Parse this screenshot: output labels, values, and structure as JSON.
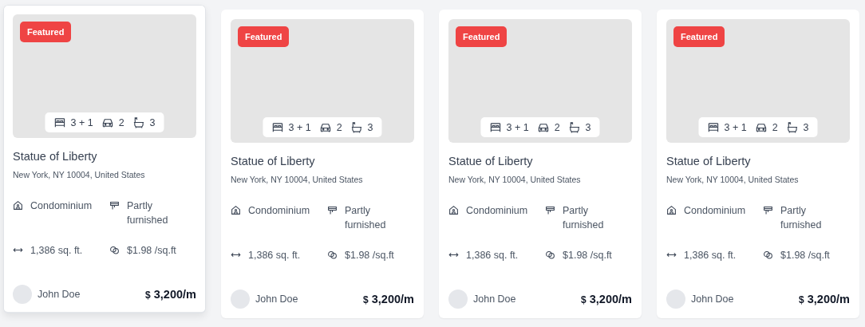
{
  "cards": [
    {
      "raised": true,
      "badge": "Featured",
      "stats": [
        {
          "kind": "beds",
          "text": "3 + 1"
        },
        {
          "kind": "parking",
          "text": "2"
        },
        {
          "kind": "baths",
          "text": "3"
        }
      ],
      "title": "Statue of Liberty",
      "address": "New York, NY 10004, United States",
      "features": [
        {
          "kind": "type",
          "text": "Condominium"
        },
        {
          "kind": "furnishing",
          "text": "Partly furnished"
        },
        {
          "kind": "area",
          "text": "1,386 sq. ft."
        },
        {
          "kind": "rate",
          "text": "$1.98 /sq.ft"
        }
      ],
      "agent": "John Doe",
      "currency": "$",
      "price": "3,200",
      "period": "/m"
    },
    {
      "raised": false,
      "badge": "Featured",
      "stats": [
        {
          "kind": "beds",
          "text": "3 + 1"
        },
        {
          "kind": "parking",
          "text": "2"
        },
        {
          "kind": "baths",
          "text": "3"
        }
      ],
      "title": "Statue of Liberty",
      "address": "New York, NY 10004, United States",
      "features": [
        {
          "kind": "type",
          "text": "Condominium"
        },
        {
          "kind": "furnishing",
          "text": "Partly furnished"
        },
        {
          "kind": "area",
          "text": "1,386 sq. ft."
        },
        {
          "kind": "rate",
          "text": "$1.98 /sq.ft"
        }
      ],
      "agent": "John Doe",
      "currency": "$",
      "price": "3,200",
      "period": "/m"
    },
    {
      "raised": false,
      "badge": "Featured",
      "stats": [
        {
          "kind": "beds",
          "text": "3 + 1"
        },
        {
          "kind": "parking",
          "text": "2"
        },
        {
          "kind": "baths",
          "text": "3"
        }
      ],
      "title": "Statue of Liberty",
      "address": "New York, NY 10004, United States",
      "features": [
        {
          "kind": "type",
          "text": "Condominium"
        },
        {
          "kind": "furnishing",
          "text": "Partly furnished"
        },
        {
          "kind": "area",
          "text": "1,386 sq. ft."
        },
        {
          "kind": "rate",
          "text": "$1.98 /sq.ft"
        }
      ],
      "agent": "John Doe",
      "currency": "$",
      "price": "3,200",
      "period": "/m"
    },
    {
      "raised": false,
      "badge": "Featured",
      "stats": [
        {
          "kind": "beds",
          "text": "3 + 1"
        },
        {
          "kind": "parking",
          "text": "2"
        },
        {
          "kind": "baths",
          "text": "3"
        }
      ],
      "title": "Statue of Liberty",
      "address": "New York, NY 10004, United States",
      "features": [
        {
          "kind": "type",
          "text": "Condominium"
        },
        {
          "kind": "furnishing",
          "text": "Partly furnished"
        },
        {
          "kind": "area",
          "text": "1,386 sq. ft."
        },
        {
          "kind": "rate",
          "text": "$1.98 /sq.ft"
        }
      ],
      "agent": "John Doe",
      "currency": "$",
      "price": "3,200",
      "period": "/m"
    }
  ]
}
